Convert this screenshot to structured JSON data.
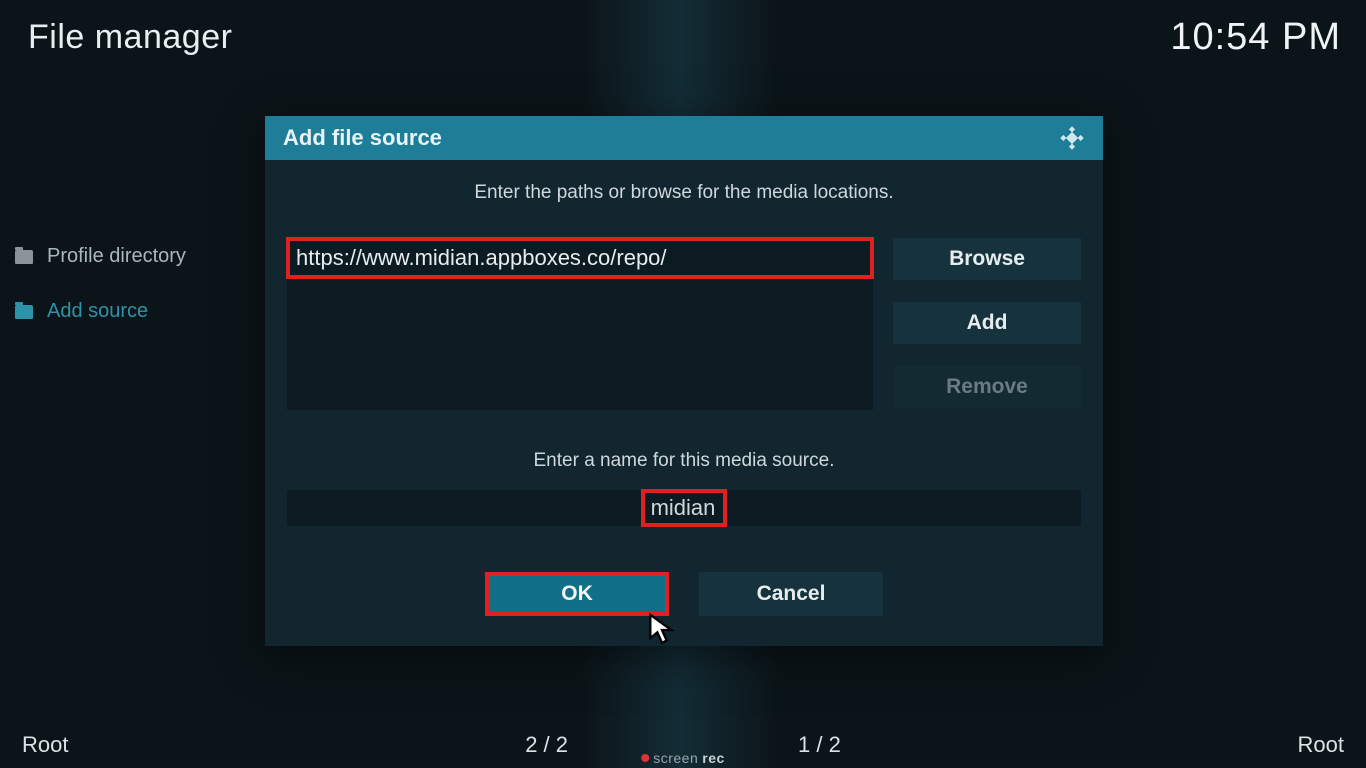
{
  "header": {
    "title": "File manager"
  },
  "clock": "10:54 PM",
  "sidebar": {
    "items": [
      {
        "label": "Profile directory"
      },
      {
        "label": "Add source"
      }
    ]
  },
  "dialog": {
    "title": "Add file source",
    "instruction": "Enter the paths or browse for the media locations.",
    "path_value": "https://www.midian.appboxes.co/repo/",
    "buttons": {
      "browse": "Browse",
      "add": "Add",
      "remove": "Remove"
    },
    "name_label": "Enter a name for this media source.",
    "name_value": "midian",
    "ok": "OK",
    "cancel": "Cancel"
  },
  "footer": {
    "left": "Root",
    "mid_left": "2 / 2",
    "mid_right": "1 / 2",
    "right": "Root"
  },
  "screenrec": {
    "brand1": "screen",
    "brand2": "rec"
  }
}
